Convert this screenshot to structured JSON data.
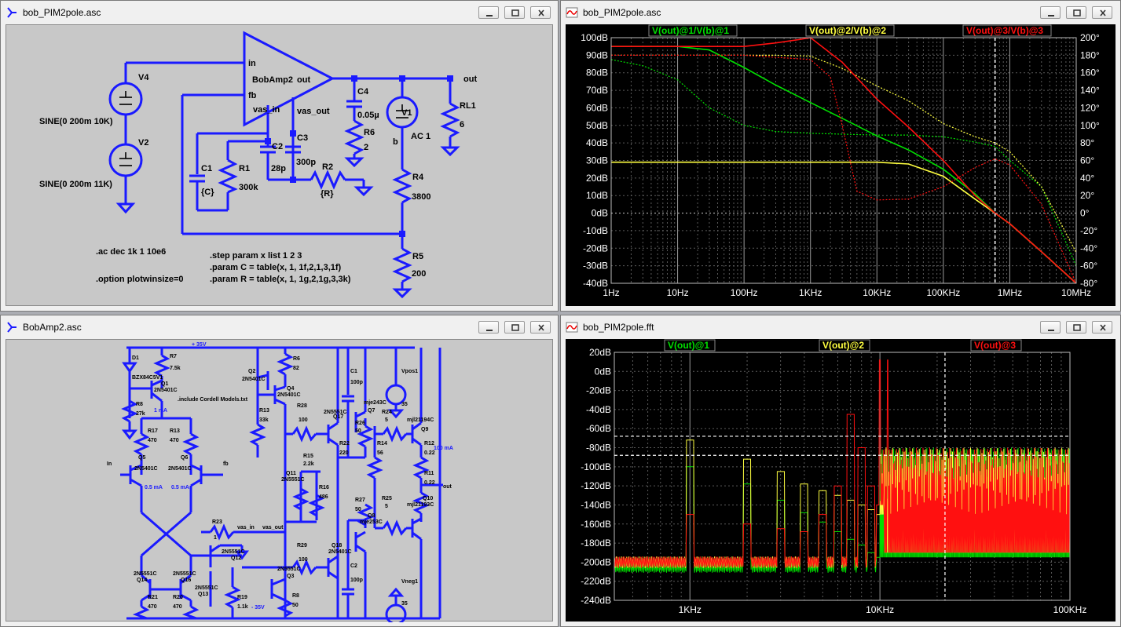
{
  "colors": {
    "wire": "#1a1aff",
    "green_trace": "#00e000",
    "yellow_trace": "#ffff40",
    "red_trace": "#ff1010",
    "schematic_bg": "#c8c8c8",
    "plot_bg": "#000000"
  },
  "windows": {
    "schematic_top": {
      "title": "bob_PIM2pole.asc",
      "labels": {
        "v4": "V4",
        "v4_sine": "SINE(0 200m 10K)",
        "v2": "V2",
        "v2_sine": "SINE(0 200m 11K)",
        "amp_in": "in",
        "amp_fb": "fb",
        "amp_name": "BobAmp2",
        "amp_out": "out",
        "vas_in": "vas_in",
        "vas_out": "vas_out",
        "c4": "C4",
        "c4_val": "0.05µ",
        "r6": "R6",
        "r6_val": "2",
        "v1": "V1",
        "v1_val": "AC 1",
        "v1_b": "b",
        "rl1": "RL1",
        "rl1_val": "6",
        "out": "out",
        "c1": "C1",
        "c1_val": "{C}",
        "r1": "R1",
        "r1_val": "300k",
        "c2": "C2",
        "c2_val": "28p",
        "c3": "C3",
        "c3_val": "300p",
        "r2": "R2",
        "r2_val": "{R}",
        "r4": "R4",
        "r4_val": "3800",
        "r5": "R5",
        "r5_val": "200",
        "ac_cmd": ".ac dec 1k 1 10e6",
        "option_cmd": ".option plotwinsize=0",
        "step_cmd": ".step param x list 1 2 3",
        "param_c": ".param C = table(x, 1, 1f,2,1,3,1f)",
        "param_r": ".param R = table(x, 1, 1g,2,1g,3,3k)"
      }
    },
    "bode_plot": {
      "title": "bob_PIM2pole.asc",
      "legend": [
        "V(out)@1/V(b)@1",
        "V(out)@2/V(b)@2",
        "V(out)@3/V(b)@3"
      ],
      "x_ticks": [
        "1Hz",
        "10Hz",
        "100Hz",
        "1KHz",
        "10KHz",
        "100KHz",
        "1MHz",
        "10MHz"
      ],
      "y_left_ticks": [
        "100dB",
        "90dB",
        "80dB",
        "70dB",
        "60dB",
        "50dB",
        "40dB",
        "30dB",
        "20dB",
        "10dB",
        "0dB",
        "-10dB",
        "-20dB",
        "-30dB",
        "-40dB"
      ],
      "y_right_ticks": [
        "200°",
        "180°",
        "160°",
        "140°",
        "120°",
        "100°",
        "80°",
        "60°",
        "40°",
        "20°",
        "0°",
        "-20°",
        "-40°",
        "-60°",
        "-80°"
      ]
    },
    "schematic_bottom": {
      "title": "BobAmp2.asc",
      "labels": {
        "plus35": "+ 35V",
        "minus35": "- 35V",
        "d1": "D1",
        "d1_model": "BZX84C5V1",
        "r7": "R7",
        "r7_val": "7.5k",
        "q1": "Q1",
        "q1_model": "2N5401C",
        "r8": "R8",
        "r8_val": "27k",
        "one_ma": "1 mA",
        "r17": "R17",
        "r17_val": "470",
        "r13a": "R13",
        "r13a_val": "470",
        "q5": "Q5",
        "q5_model": "2N5401C",
        "q6": "Q6",
        "q6_model": "2N5401C",
        "in": "In",
        "fb": "fb",
        "half_ma_a": "0.5 mA",
        "half_ma_b": "0.5 mA",
        "q2": "Q2",
        "q2_model": "2N5401C",
        "r6b": "R6",
        "r6b_val": "82",
        "q4": "Q4",
        "q4_model": "2N5401C",
        "include": ".include Cordell Models.txt",
        "r13b": "R13",
        "r13b_val": "33k",
        "r28": "R28",
        "r28_val": "100",
        "q17": "Q17",
        "q17_model": "2N5551C",
        "c1b": "C1",
        "c1b_val": "100p",
        "r26": "R26",
        "r26_val": "50",
        "q7": "Q7",
        "q7_model": "mje243C",
        "vpos": "Vpos1",
        "vpos_val": "35",
        "r24": "R24",
        "r24_val": "5",
        "q9": "Q9",
        "q9_model": "mjl21194C",
        "r12": "R12",
        "r12_val": "0.22",
        "hundred_ma": "100 mA",
        "out": "out",
        "r11": "R11",
        "r11_val": "0.22",
        "r22": "R22",
        "r22_val": "220",
        "r14": "R14",
        "r14_val": "56",
        "r15": "R15",
        "r15_val": "2.2k",
        "q11": "Q11",
        "q11_model": "2N5551C",
        "r16": "R16",
        "r16_val": "486",
        "r23": "R23",
        "r23_val": "1",
        "vas_in": "vas_in",
        "vas_out": "vas_out",
        "r27": "R27",
        "r27_val": "50",
        "q8": "Q8",
        "q8_model": "mje253C",
        "r25": "R25",
        "r25_val": "5",
        "q10": "Q10",
        "q10_model": "mjl21193C",
        "q12": "Q12",
        "q12_model": "2N5551C",
        "q14": "Q14",
        "q14_model": "2N5551C",
        "q16": "Q16",
        "q16_model": "2N5551C",
        "q13": "Q13",
        "q13_model": "2N5551C",
        "r29": "R29",
        "r29_val": "100",
        "q3": "Q3",
        "q3_model": "2N5551C",
        "q18": "Q18",
        "q18_model": "2N5401C",
        "c2b": "C2",
        "c2b_val": "100p",
        "vneg": "Vneg1",
        "vneg_val": "35",
        "r21": "R21",
        "r21_val": "470",
        "r20": "R20",
        "r20_val": "470",
        "r19": "R19",
        "r19_val": "1.1k",
        "r8b": "R8",
        "r8b_val": "50"
      }
    },
    "fft_plot": {
      "title": "bob_PIM2pole.fft",
      "legend": [
        "V(out)@1",
        "V(out)@2",
        "V(out)@3"
      ],
      "x_ticks": [
        "1KHz",
        "10KHz",
        "100KHz"
      ],
      "y_ticks": [
        "20dB",
        "0dB",
        "-20dB",
        "-40dB",
        "-60dB",
        "-80dB",
        "-100dB",
        "-120dB",
        "-140dB",
        "-160dB",
        "-180dB",
        "-200dB",
        "-220dB",
        "-240dB"
      ]
    }
  },
  "chart_data": [
    {
      "type": "line",
      "x_scale": "log",
      "xlim": [
        1,
        10000000
      ],
      "ylim": [
        -40,
        100
      ],
      "y2lim": [
        -80,
        200
      ],
      "grid": true,
      "legend_placement": "top",
      "series": [
        {
          "name": "V(out)@1/V(b)@1",
          "x": [
            1,
            10,
            30,
            100,
            300,
            1000,
            3000,
            10000,
            30000,
            100000,
            300000,
            600000,
            1000000,
            3000000,
            10000000
          ],
          "values": [
            95,
            95,
            93,
            83,
            73,
            63,
            54,
            44,
            36,
            25,
            11,
            0,
            -6,
            -22,
            -40
          ],
          "phase_x": [
            1,
            3,
            10,
            30,
            100,
            300,
            1000,
            3000,
            10000,
            30000,
            100000,
            300000,
            600000,
            1000000,
            3000000,
            10000000
          ],
          "phase_values": [
            175,
            168,
            152,
            120,
            100,
            93,
            91,
            90,
            89,
            89,
            87,
            81,
            76,
            60,
            30,
            -60
          ]
        },
        {
          "name": "V(out)@2/V(b)@2",
          "x": [
            1,
            100,
            1000,
            10000,
            30000,
            100000,
            300000,
            600000,
            1000000,
            3000000,
            10000000
          ],
          "values": [
            29,
            29,
            29,
            29,
            28,
            21,
            8,
            0,
            -6,
            -22,
            -40
          ],
          "phase_x": [
            1,
            100,
            300,
            1000,
            3000,
            10000,
            30000,
            100000,
            300000,
            600000,
            1000000,
            3000000,
            10000000
          ],
          "phase_values": [
            180,
            180,
            180,
            179,
            165,
            145,
            128,
            102,
            87,
            80,
            70,
            30,
            -45
          ]
        },
        {
          "name": "V(out)@3/V(b)@3",
          "x": [
            1,
            10,
            100,
            300,
            700,
            1000,
            3000,
            10000,
            30000,
            100000,
            300000,
            600000,
            1000000,
            3000000,
            10000000
          ],
          "values": [
            95,
            95,
            95,
            97,
            99,
            100,
            86,
            65,
            49,
            30,
            10,
            0,
            -6,
            -22,
            -40
          ],
          "phase_x": [
            1,
            100,
            1000,
            2000,
            3000,
            5000,
            10000,
            30000,
            100000,
            300000,
            600000,
            1000000,
            3000000,
            10000000
          ],
          "phase_values": [
            180,
            180,
            175,
            155,
            100,
            25,
            15,
            16,
            30,
            52,
            62,
            55,
            10,
            -80
          ]
        }
      ]
    },
    {
      "type": "line",
      "x_scale": "log",
      "xlim": [
        400,
        100000
      ],
      "ylim": [
        -240,
        20
      ],
      "grid": true,
      "legend_placement": "top",
      "series": [
        {
          "name": "V(out)@1",
          "tone_peaks_db": [
            -100,
            -118,
            -135,
            -148,
            -158,
            -168,
            -176,
            -182,
            -190,
            -195
          ],
          "noise_floor_db": -205
        },
        {
          "name": "V(out)@2",
          "tone_peaks_db": [
            -72,
            -92,
            -105,
            -118,
            -125,
            -130,
            -135,
            -140,
            -145,
            -150
          ],
          "noise_floor_db": -200
        },
        {
          "name": "V(out)@3",
          "tone_peaks_db": [
            -150,
            -160,
            -165,
            -168,
            -150,
            -120,
            -45,
            -80,
            -120,
            -140
          ],
          "spikes_khz": [
            10,
            11
          ],
          "spike_peak_db": 12,
          "noise_floor_db": -200
        }
      ]
    }
  ]
}
